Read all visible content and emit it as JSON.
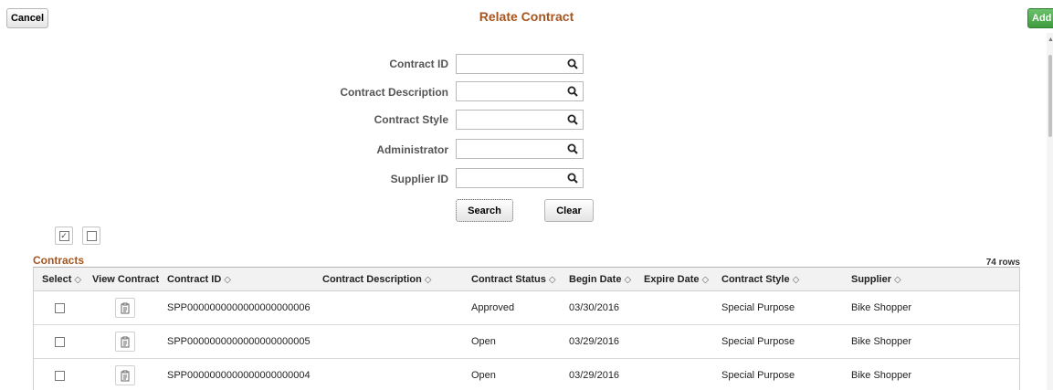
{
  "header": {
    "title": "Relate Contract",
    "cancel_label": "Cancel",
    "add_label": "Add"
  },
  "search_form": {
    "fields": [
      {
        "label": "Contract ID",
        "value": ""
      },
      {
        "label": "Contract Description",
        "value": ""
      },
      {
        "label": "Contract Style",
        "value": ""
      },
      {
        "label": "Administrator",
        "value": ""
      },
      {
        "label": "Supplier ID",
        "value": ""
      }
    ],
    "search_label": "Search",
    "clear_label": "Clear"
  },
  "select_buttons": {
    "select_all_icon": "checked-box-icon",
    "deselect_all_icon": "empty-box-icon"
  },
  "grid": {
    "title": "Contracts",
    "row_count": "74 rows",
    "sort_icon": "◇",
    "columns": {
      "select": "Select",
      "view_contract": "View Contract",
      "contract_id": "Contract ID",
      "contract_description": "Contract Description",
      "contract_status": "Contract Status",
      "begin_date": "Begin Date",
      "expire_date": "Expire Date",
      "contract_style": "Contract Style",
      "supplier": "Supplier"
    },
    "rows": [
      {
        "contract_id": "SPP0000000000000000000006",
        "description": "",
        "status": "Approved",
        "begin_date": "03/30/2016",
        "expire_date": "",
        "style": "Special Purpose",
        "supplier": "Bike Shopper"
      },
      {
        "contract_id": "SPP0000000000000000000005",
        "description": "",
        "status": "Open",
        "begin_date": "03/29/2016",
        "expire_date": "",
        "style": "Special Purpose",
        "supplier": "Bike Shopper"
      },
      {
        "contract_id": "SPP0000000000000000000004",
        "description": "",
        "status": "Open",
        "begin_date": "03/29/2016",
        "expire_date": "",
        "style": "Special Purpose",
        "supplier": "Bike Shopper"
      }
    ]
  },
  "colors": {
    "accent": "#a7551e",
    "add_button": "#3f9b3f"
  }
}
